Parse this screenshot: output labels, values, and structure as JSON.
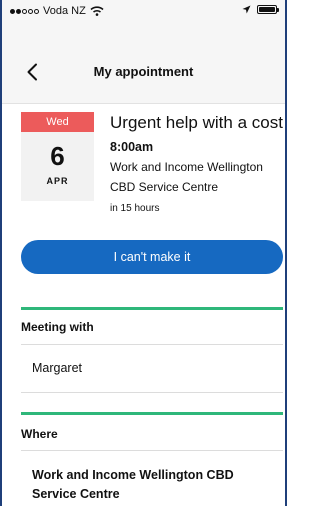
{
  "status": {
    "carrier": "Voda NZ"
  },
  "header": {
    "title": "My appointment"
  },
  "calendar": {
    "weekday": "Wed",
    "day": "6",
    "month": "APR",
    "accent": "#ec5b5b"
  },
  "appointment": {
    "title": "Urgent help with a cost",
    "time": "8:00am",
    "location_line1": "Work and Income Wellington",
    "location_line2": "CBD Service Centre",
    "relative_time": "in 15 hours"
  },
  "actions": {
    "cant_make_it": "I can't make it"
  },
  "meeting": {
    "heading": "Meeting with",
    "name": "Margaret"
  },
  "where": {
    "heading": "Where",
    "line1": "Work and Income Wellington CBD",
    "line2": "Service Centre"
  },
  "colors": {
    "primary": "#1669c1",
    "section_accent": "#2fb77a"
  }
}
